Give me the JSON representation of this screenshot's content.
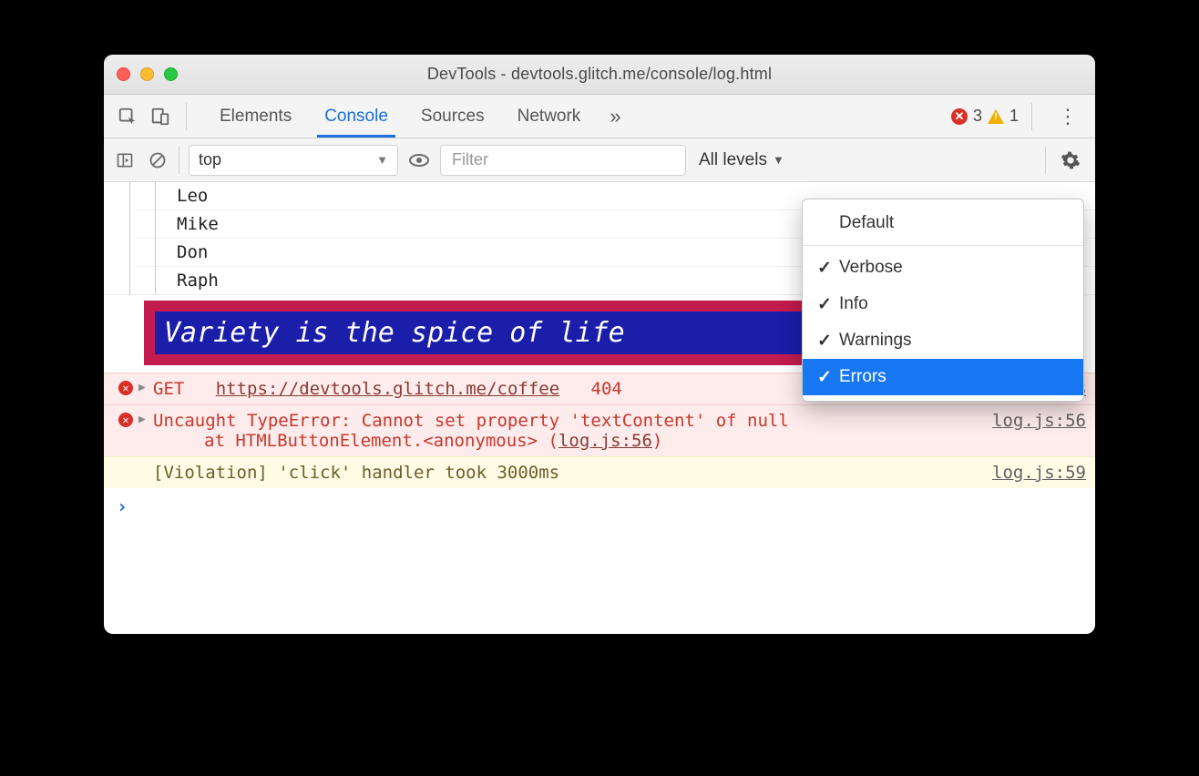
{
  "window": {
    "title": "DevTools - devtools.glitch.me/console/log.html"
  },
  "tabs": {
    "items": [
      "Elements",
      "Console",
      "Sources",
      "Network"
    ],
    "selected_index": 1,
    "more_glyph": "»"
  },
  "badges": {
    "errors": "3",
    "warnings": "1"
  },
  "toolbar": {
    "context": "top",
    "filter_placeholder": "Filter",
    "levels_label": "All levels",
    "caret": "▼"
  },
  "levels_menu": {
    "default_label": "Default",
    "items": [
      {
        "label": "Verbose",
        "checked": true,
        "selected": false
      },
      {
        "label": "Info",
        "checked": true,
        "selected": false
      },
      {
        "label": "Warnings",
        "checked": true,
        "selected": false
      },
      {
        "label": "Errors",
        "checked": true,
        "selected": true
      }
    ]
  },
  "log_tree": [
    "Leo",
    "Mike",
    "Don",
    "Raph"
  ],
  "styled_message": "Variety is the spice of life",
  "errors": [
    {
      "prefix": "GET",
      "url": "https://devtools.glitch.me/coffee",
      "status": "404",
      "source": "log.js:68"
    },
    {
      "line1": "Uncaught TypeError: Cannot set property 'textContent' of null",
      "line2_pre": "at HTMLButtonElement.<anonymous> (",
      "line2_link": "log.js:56",
      "line2_post": ")",
      "source": "log.js:56"
    }
  ],
  "violation": {
    "text": "[Violation] 'click' handler took 3000ms",
    "source": "log.js:59"
  },
  "prompt_glyph": "›",
  "check_glyph": "✓"
}
